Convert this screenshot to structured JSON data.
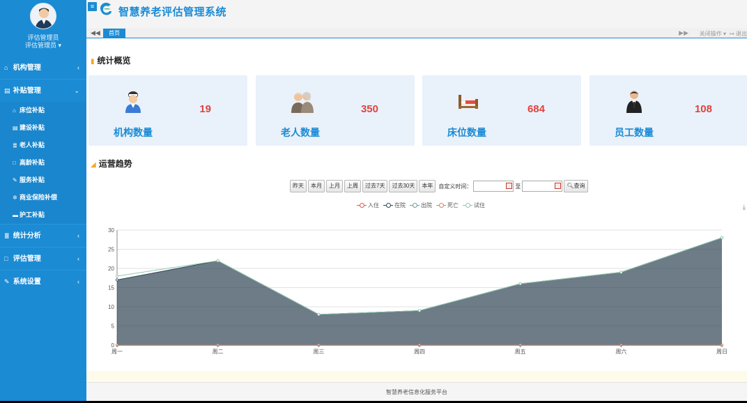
{
  "user": {
    "name": "评估管理员",
    "role": "评估管理员 ▾"
  },
  "app": {
    "title": "智慧养老评估管理系统",
    "toggle_icon": "menu-icon"
  },
  "tabs": {
    "home": "首页",
    "close_ops": "关闭操作 ▾",
    "exit": "退出"
  },
  "menu": {
    "items": [
      {
        "label": "机构管理",
        "icon": "home-icon"
      },
      {
        "label": "补贴管理",
        "icon": "book-icon"
      },
      {
        "label": "统计分析",
        "icon": "list-icon"
      },
      {
        "label": "评估管理",
        "icon": "folder-icon"
      },
      {
        "label": "系统设置",
        "icon": "pencil-icon"
      }
    ],
    "subitems": [
      {
        "label": "床位补贴",
        "icon": "home-icon"
      },
      {
        "label": "建设补贴",
        "icon": "book-icon"
      },
      {
        "label": "老人补贴",
        "icon": "list-icon"
      },
      {
        "label": "高龄补贴",
        "icon": "folder-icon"
      },
      {
        "label": "服务补贴",
        "icon": "pencil-icon"
      },
      {
        "label": "商业保险补偿",
        "icon": "gear-icon"
      },
      {
        "label": "护工补贴",
        "icon": "card-icon"
      }
    ]
  },
  "overview": {
    "title": "统计概览",
    "cards": [
      {
        "label": "机构数量",
        "value": "19",
        "icon": "nurse-icon"
      },
      {
        "label": "老人数量",
        "value": "350",
        "icon": "elderly-icon"
      },
      {
        "label": "床位数量",
        "value": "684",
        "icon": "bed-icon"
      },
      {
        "label": "员工数量",
        "value": "108",
        "icon": "staff-icon"
      }
    ]
  },
  "trend": {
    "title": "运营趋势",
    "buttons": [
      "昨天",
      "本月",
      "上月",
      "上周",
      "过去7天",
      "过去30天",
      "本年"
    ],
    "custom_label": "自定义时间：",
    "to_label": "至",
    "query_label": "查询"
  },
  "footer": {
    "text": "智慧养老信息化服务平台"
  },
  "chart_data": {
    "type": "area",
    "categories": [
      "周一",
      "周二",
      "周三",
      "周四",
      "周五",
      "周六",
      "周日"
    ],
    "ylim": [
      0,
      30
    ],
    "yticks": [
      0,
      5,
      10,
      15,
      20,
      25,
      30
    ],
    "legend_position": "top-center",
    "grid": true,
    "series": [
      {
        "name": "入住",
        "color": "#e05a4a",
        "values": [
          0,
          0,
          0,
          0,
          0,
          0,
          0
        ]
      },
      {
        "name": "在院",
        "color": "#2f4554",
        "values": [
          17,
          22,
          8,
          9,
          16,
          19,
          28
        ]
      },
      {
        "name": "出院",
        "color": "#61a0a8",
        "values": [
          0,
          0,
          0,
          0,
          0,
          0,
          0
        ]
      },
      {
        "name": "死亡",
        "color": "#d48265",
        "values": [
          0,
          0,
          0,
          0,
          0,
          0,
          0
        ]
      },
      {
        "name": "试住",
        "color": "#91c7ae",
        "values": [
          18,
          22,
          8,
          9,
          16,
          19,
          28
        ]
      }
    ]
  }
}
